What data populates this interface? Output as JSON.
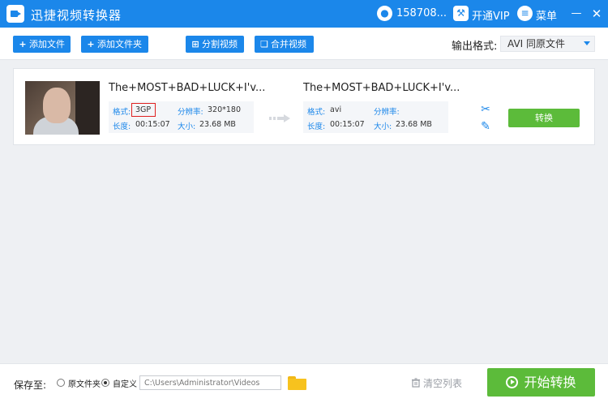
{
  "app": {
    "title": "迅捷视频转换器"
  },
  "header": {
    "user_name": "158708...",
    "vip_label": "开通VIP",
    "menu_label": "菜单",
    "minimize_icon": "minimize-icon",
    "close_icon": "close-icon"
  },
  "toolbar": {
    "add_file": "添加文件",
    "add_folder": "添加文件夹",
    "split_video": "分割视频",
    "merge_video": "合并视频",
    "output_format_label": "输出格式:",
    "output_format_value": "AVI  同原文件"
  },
  "file_item": {
    "source": {
      "name": "The+MOST+BAD+LUCK+I'v...",
      "format_key": "格式:",
      "format_value": "3GP",
      "resolution_key": "分辨率:",
      "resolution_value": "320*180",
      "duration_key": "长度:",
      "duration_value": "00:15:07",
      "size_key": "大小:",
      "size_value": "23.68 MB"
    },
    "target": {
      "name": "The+MOST+BAD+LUCK+I'v...",
      "format_key": "格式:",
      "format_value": "avi",
      "resolution_key": "分辨率:",
      "resolution_value": "",
      "duration_key": "长度:",
      "duration_value": "00:15:07",
      "size_key": "大小:",
      "size_value": "23.68 MB"
    },
    "convert_label": "转换"
  },
  "footer": {
    "save_to_label": "保存至:",
    "option_source_folder": "原文件夹",
    "option_custom": "自定义",
    "path_value": "C:\\Users\\Administrator\\Videos",
    "clear_list_label": "清空列表",
    "start_convert_label": "开始转换"
  },
  "colors": {
    "primary": "#1b87ea",
    "success": "#5cbb3a",
    "highlight_border": "#e02020"
  }
}
